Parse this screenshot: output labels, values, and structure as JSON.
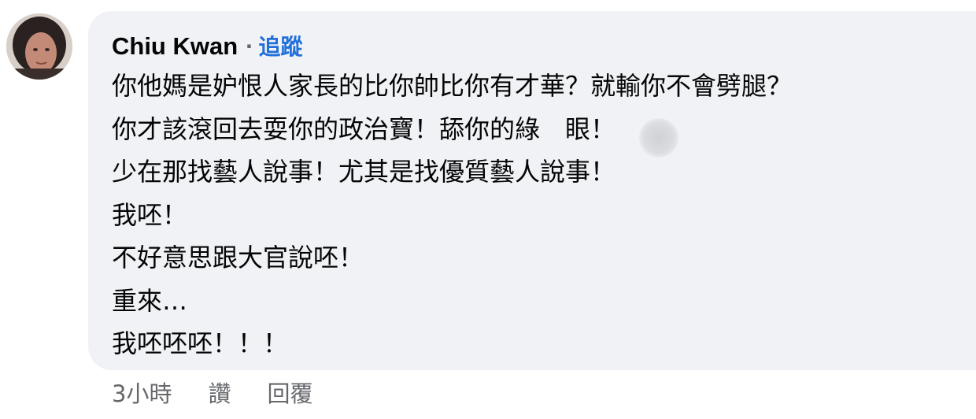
{
  "comment": {
    "author": "Chiu Kwan",
    "separator": "·",
    "follow_label": "追蹤",
    "lines": [
      "你他媽是妒恨人家長的比你帥比你有才華？就輸你不會劈腿？",
      "你才該滾回去耍你的政治寶！舔你的綠　眼！",
      "少在那找藝人說事！尤其是找優質藝人說事！",
      "我呸！",
      "不好意思跟大官說呸！",
      "重來…",
      "我呸呸呸！！！"
    ],
    "time": "3小時",
    "actions": {
      "like_label": "讚",
      "reply_label": "回覆"
    }
  },
  "colors": {
    "bubble_background": "#f0f2f5",
    "link_blue": "#216fdb",
    "meta_gray": "#65676b",
    "text": "#050505"
  }
}
